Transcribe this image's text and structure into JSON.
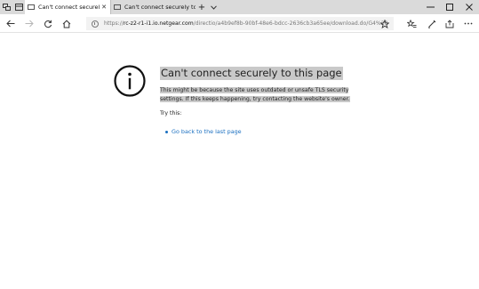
{
  "browser": {
    "tabs": [
      {
        "title": "Can't connect securely t",
        "active": true
      },
      {
        "title": "Can't connect securely to th",
        "active": false
      }
    ],
    "new_tab_symbol": "+",
    "address": {
      "scheme": "https://",
      "host": "rc-z2-r1-i1.io.netgear.com",
      "path": "/directio/a4b9ef8b-90bf-48e6-bdcc-2636cb3a65ee/download.do/G4%20"
    }
  },
  "page": {
    "headline": "Can't connect securely to this page",
    "description": "This might be because the site uses outdated or unsafe TLS security settings. If this keeps happening, try contacting the website's owner.",
    "try_this": "Try this:",
    "suggestions": [
      {
        "label": "Go back to the last page"
      }
    ]
  },
  "colors": {
    "link": "#1a6fc0",
    "highlight": "#c9c9c9",
    "tabstrip": "#dadada"
  },
  "icons": {
    "info": "info-circle-icon",
    "favorites": "star-icon",
    "refresh": "refresh-icon",
    "home": "home-icon"
  }
}
